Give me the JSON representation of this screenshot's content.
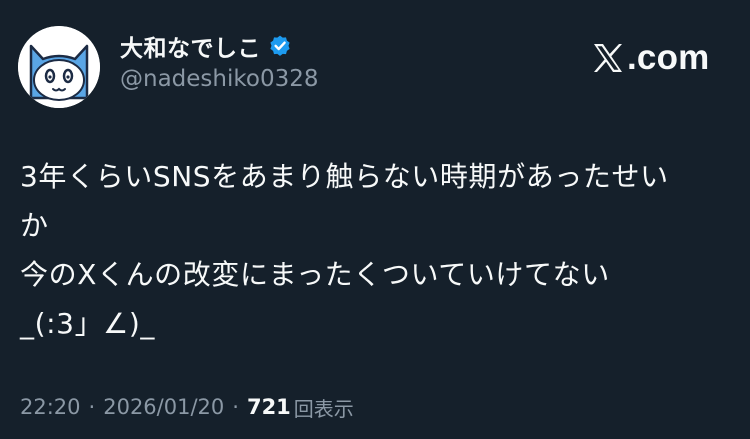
{
  "author": {
    "display_name": "大和なでしこ",
    "handle": "@nadeshiko0328",
    "verified": true,
    "avatar_icon": "cat-face-avatar-icon",
    "avatar_colors": {
      "body": "#5aa6e6",
      "inner": "#ffffff",
      "outline": "#1c2b44"
    }
  },
  "site": {
    "label": ".com",
    "logo_icon": "x-logo-icon"
  },
  "tweet": {
    "lines": [
      "3年くらいSNSをあまり触らない時期があったせい",
      "か",
      "今のXくんの改変にまったくついていけてない",
      "_(:3」∠)_"
    ]
  },
  "meta": {
    "time": "22:20",
    "separator": "·",
    "date": "2026/01/20",
    "views_count": "721",
    "views_label": "回表示"
  },
  "colors": {
    "background": "#15202b",
    "primary_text": "#f7f9f9",
    "secondary_text": "#8b98a5",
    "verified_badge": "#1d9bf0"
  }
}
